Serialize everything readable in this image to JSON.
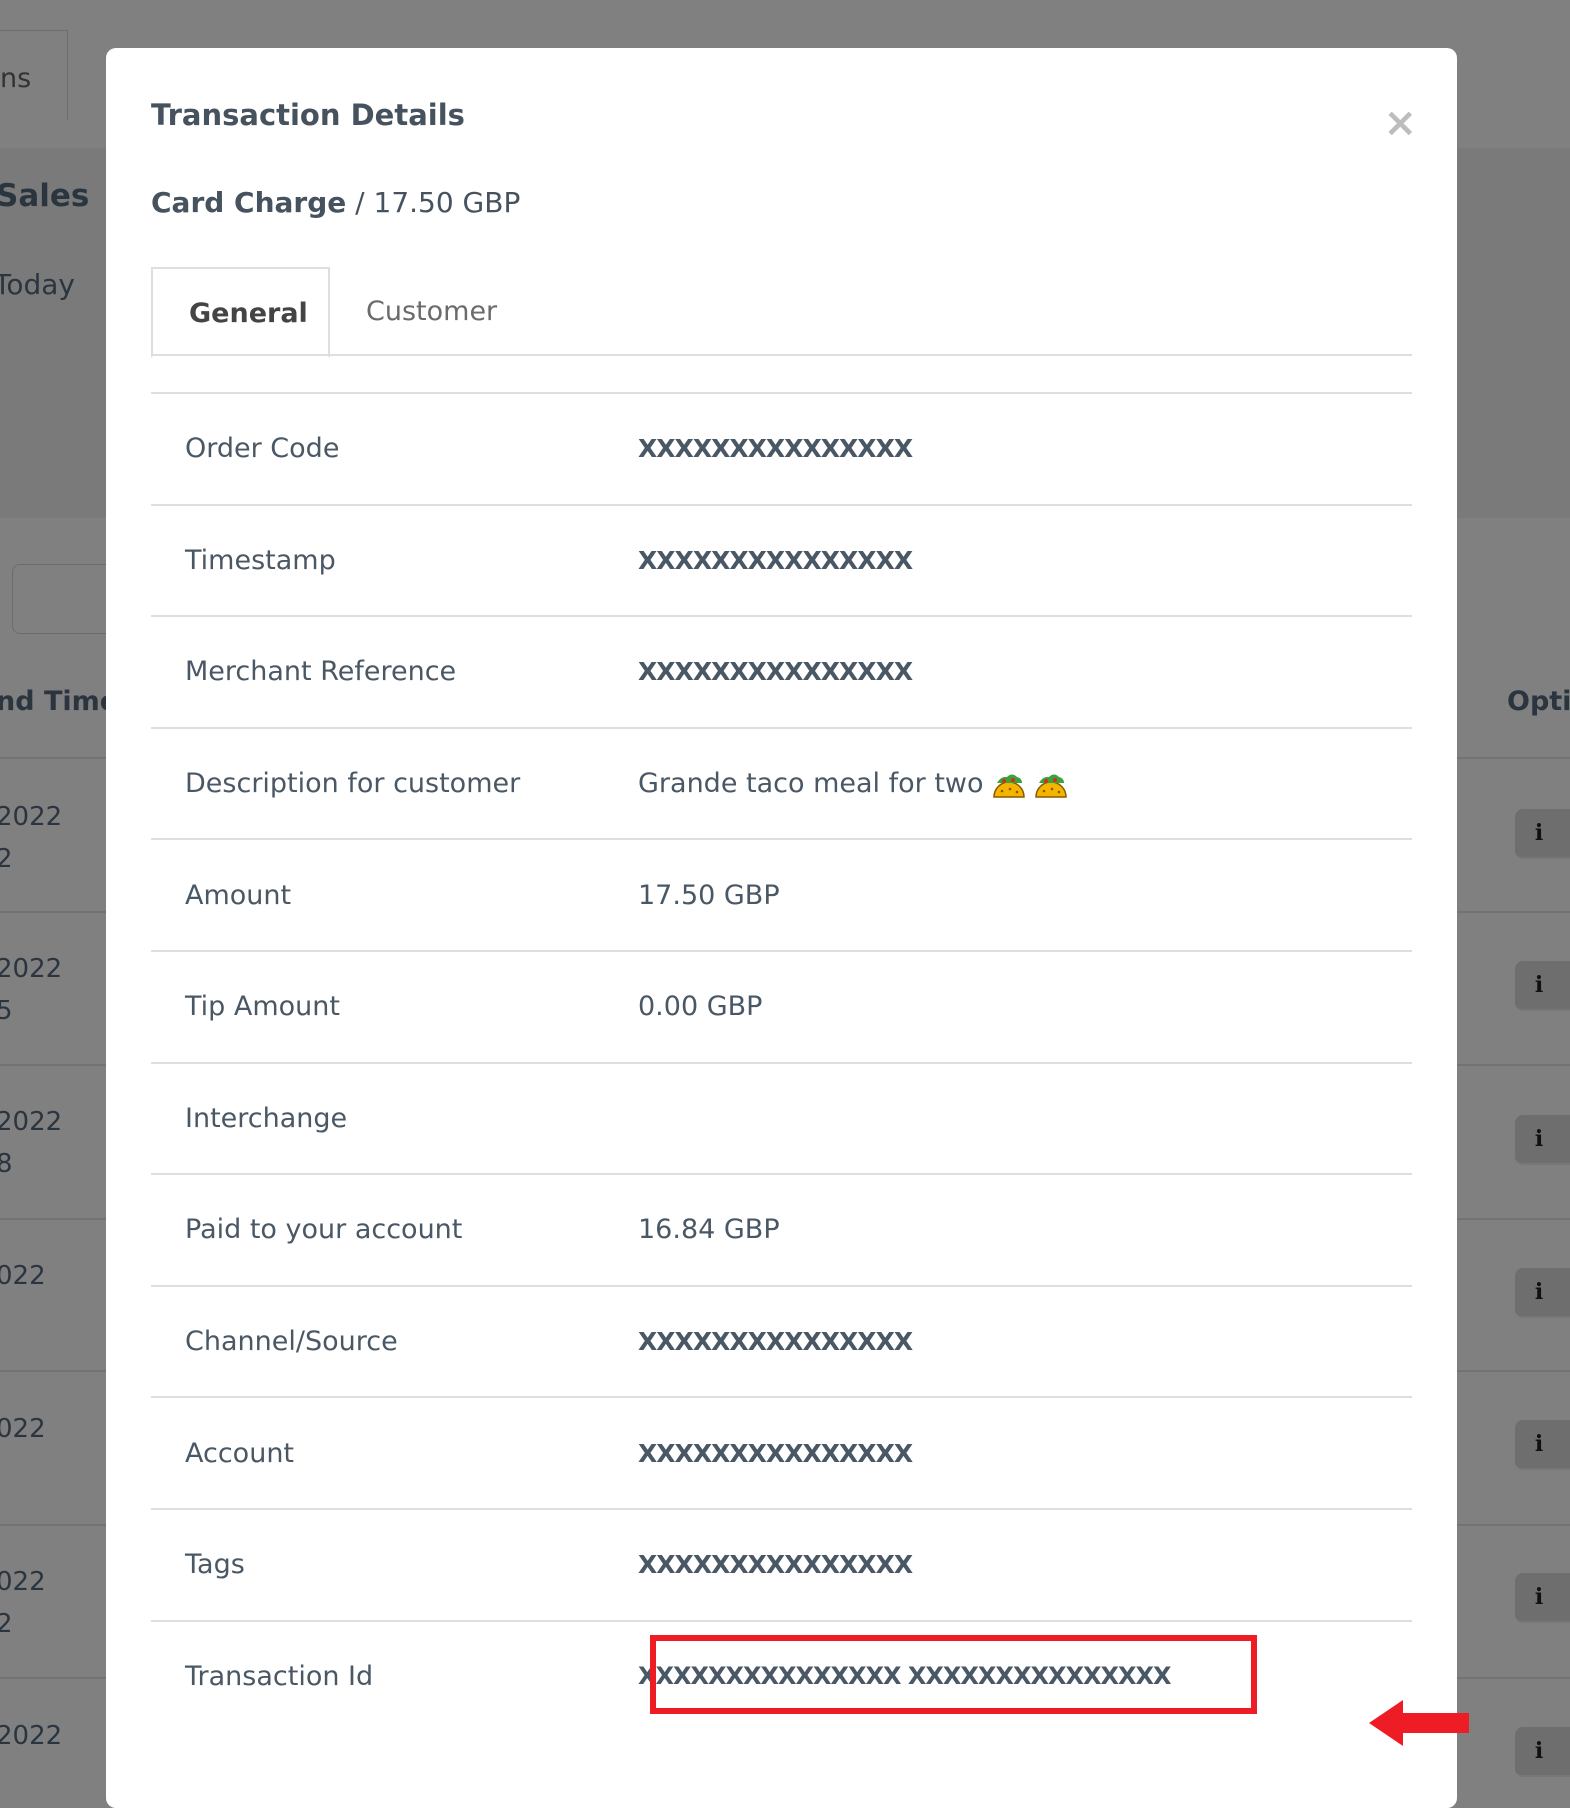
{
  "background": {
    "tab_fragment": "ns",
    "sales_fragment": "Sales",
    "today_fragment": "Today",
    "date_time_header_fragment": "nd Time",
    "options_header_fragment": "Opti",
    "dates": [
      [
        "2022",
        "2"
      ],
      [
        "2022",
        "5"
      ],
      [
        "2022",
        "8"
      ],
      [
        "022",
        ""
      ],
      [
        "022",
        ""
      ],
      [
        "022",
        "2"
      ],
      [
        "2022",
        ""
      ]
    ],
    "info_button_label": "i"
  },
  "modal": {
    "title": "Transaction Details",
    "close_icon": "close-x-icon",
    "subtitle_type": "Card Charge",
    "subtitle_amount": " / 17.50 GBP",
    "tabs": [
      {
        "label": "General",
        "active": true
      },
      {
        "label": "Customer",
        "active": false
      }
    ],
    "rows": [
      {
        "label": "Order Code",
        "value": "XXXXXXXXXXXXXXX",
        "redacted": true
      },
      {
        "label": "Timestamp",
        "value": "XXXXXXXXXXXXXXX",
        "redacted": true
      },
      {
        "label": "Merchant Reference",
        "value": "XXXXXXXXXXXXXXX",
        "redacted": true
      },
      {
        "label": "Description for customer",
        "value": "Grande taco meal for two",
        "emoji": [
          "taco-icon",
          "taco-icon"
        ]
      },
      {
        "label": "Amount",
        "value": "17.50 GBP"
      },
      {
        "label": "Tip Amount",
        "value": "0.00 GBP"
      },
      {
        "label": "Interchange",
        "value": ""
      },
      {
        "label": "Paid to your account",
        "value": "16.84 GBP"
      },
      {
        "label": "Channel/Source",
        "value": "XXXXXXXXXXXXXXX",
        "redacted": true
      },
      {
        "label": "Account",
        "value": "XXXXXXXXXXXXXXX",
        "redacted": true
      },
      {
        "label": "Tags",
        "value": "XXXXXXXXXXXXXXX",
        "redacted": true
      },
      {
        "label": "Transaction Id",
        "value": "XXXXXXXXXXXXXXX XXXXXXXXXXXXXXX",
        "redacted": true,
        "highlighted": true
      }
    ]
  },
  "annotation": {
    "color": "#ee1c25",
    "arrow": "arrow-left-icon"
  }
}
